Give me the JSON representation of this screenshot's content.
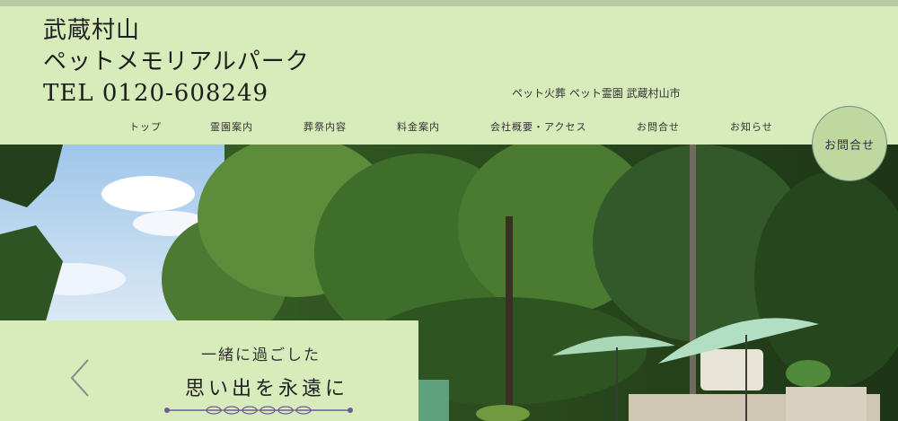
{
  "header": {
    "brand_line1": "武蔵村山",
    "brand_line2": "ペットメモリアルパーク",
    "phone": "TEL 0120-608249",
    "tagline": "ペット火葬 ペット霊園 武蔵村山市"
  },
  "nav": {
    "items": [
      "トップ",
      "霊園案内",
      "葬祭内容",
      "料金案内",
      "会社概要・アクセス",
      "お問合せ",
      "お知らせ"
    ]
  },
  "contact_button": "お問合せ",
  "hero": {
    "caption_line1": "一緒に過ごした",
    "caption_line2": "思い出を永遠に"
  },
  "colors": {
    "header_bg": "#d8ebba",
    "accent_purple": "#6e5c97"
  },
  "icons": [
    "chevron-left-icon"
  ]
}
